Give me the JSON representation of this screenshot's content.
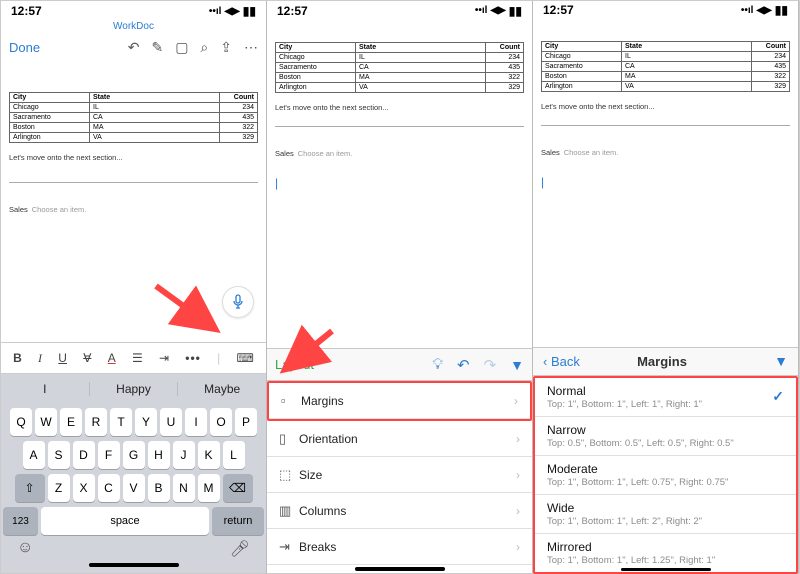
{
  "status": {
    "time": "12:57"
  },
  "header": {
    "title": "WorkDoc",
    "done": "Done"
  },
  "table": {
    "headers": [
      "City",
      "State",
      "Count"
    ],
    "rows": [
      [
        "Chicago",
        "IL",
        "234"
      ],
      [
        "Sacramento",
        "CA",
        "435"
      ],
      [
        "Boston",
        "MA",
        "322"
      ],
      [
        "Arlington",
        "VA",
        "329"
      ]
    ]
  },
  "doc_line": "Let's move onto the next section...",
  "sales": {
    "label": "Sales",
    "placeholder": "Choose an item."
  },
  "suggestions": [
    "I",
    "Happy",
    "Maybe"
  ],
  "keyboard": {
    "row1": [
      "Q",
      "W",
      "E",
      "R",
      "T",
      "Y",
      "U",
      "I",
      "O",
      "P"
    ],
    "row2": [
      "A",
      "S",
      "D",
      "F",
      "G",
      "H",
      "J",
      "K",
      "L"
    ],
    "row3": [
      "Z",
      "X",
      "C",
      "V",
      "B",
      "N",
      "M"
    ],
    "num": "123",
    "space": "space",
    "ret": "return"
  },
  "ribbon": {
    "title": "Layout"
  },
  "layout_menu": [
    {
      "icon": "▢",
      "label": "Margins"
    },
    {
      "icon": "▯",
      "label": "Orientation"
    },
    {
      "icon": "⤢",
      "label": "Size"
    },
    {
      "icon": "▥",
      "label": "Columns"
    },
    {
      "icon": "�католи",
      "label": "Breaks"
    }
  ],
  "margins_panel": {
    "back": "Back",
    "title": "Margins",
    "options": [
      {
        "name": "Normal",
        "desc": "Top: 1\", Bottom: 1\", Left: 1\", Right: 1\"",
        "selected": true
      },
      {
        "name": "Narrow",
        "desc": "Top: 0.5\", Bottom: 0.5\", Left: 0.5\", Right: 0.5\""
      },
      {
        "name": "Moderate",
        "desc": "Top: 1\", Bottom: 1\", Left: 0.75\", Right: 0.75\""
      },
      {
        "name": "Wide",
        "desc": "Top: 1\", Bottom: 1\", Left: 2\", Right: 2\""
      },
      {
        "name": "Mirrored",
        "desc": "Top: 1\", Bottom: 1\", Left: 1.25\", Right: 1\""
      }
    ]
  }
}
